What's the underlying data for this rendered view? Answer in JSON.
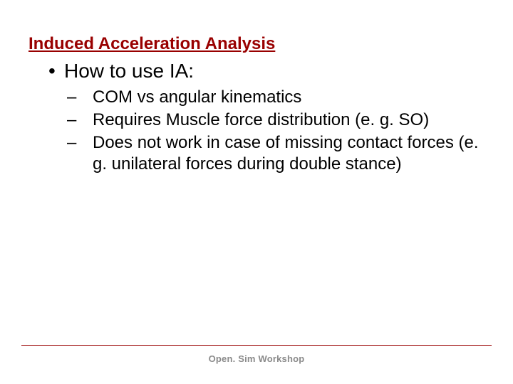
{
  "title": "Induced Acceleration Analysis",
  "bullet": "How to use IA:",
  "subs": [
    "COM vs angular kinematics",
    "Requires Muscle force distribution (e. g. SO)",
    "Does not work in case of missing contact forces (e. g. unilateral forces during double stance)"
  ],
  "footer": "Open. Sim Workshop"
}
